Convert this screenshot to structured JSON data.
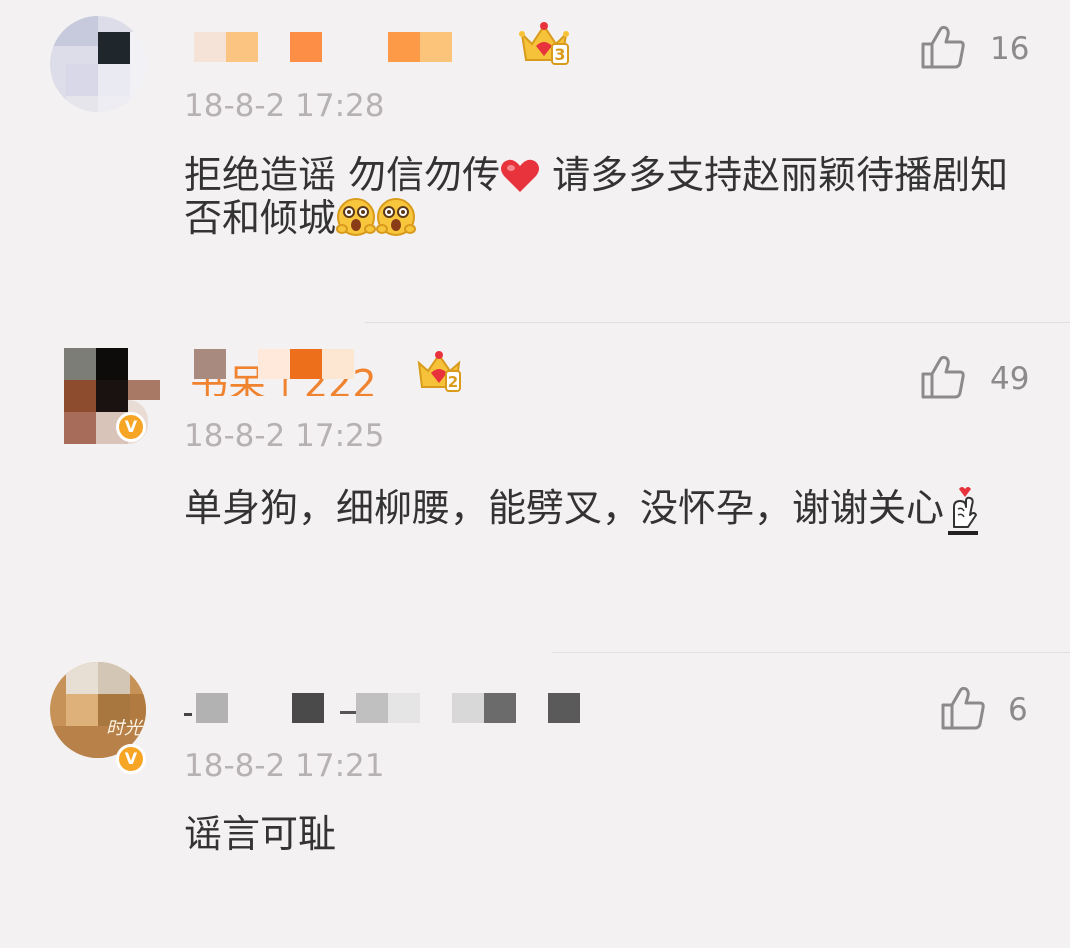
{
  "comments": [
    {
      "timestamp": "18-8-2 17:28",
      "text": "拒绝造谣 勿信勿传",
      "text_after_heart": " 请多多支持赵丽颖待播剧知否和倾城",
      "likes": "16",
      "crown_level": "3",
      "verified": false
    },
    {
      "name_partial": "书呆了222号",
      "timestamp": "18-8-2 17:25",
      "text": "单身狗，细柳腰，能劈叉，没怀孕，谢谢关心",
      "likes": "49",
      "crown_level": "2",
      "verified": true,
      "verified_mark": "V"
    },
    {
      "timestamp": "18-8-2 17:21",
      "text": "谣言可耻",
      "likes": "6",
      "verified": true,
      "verified_mark": "V",
      "avatar_text": "时光"
    }
  ],
  "icons": {
    "like": "thumbs-up-outline-icon",
    "crown": "crown-badge-icon",
    "heart": "red-heart-emoji",
    "shocked_face": "shocked-face-emoji",
    "finger_heart": "finger-heart-emoji"
  },
  "colors": {
    "background": "#f4f1f2",
    "text": "#333333",
    "timestamp": "#b6b1b3",
    "like": "#8d8a8b",
    "name_orange": "#f08330",
    "verified_badge": "#f6a524",
    "crown_gold": "#f5c23a",
    "heart_red": "#e8323c"
  }
}
